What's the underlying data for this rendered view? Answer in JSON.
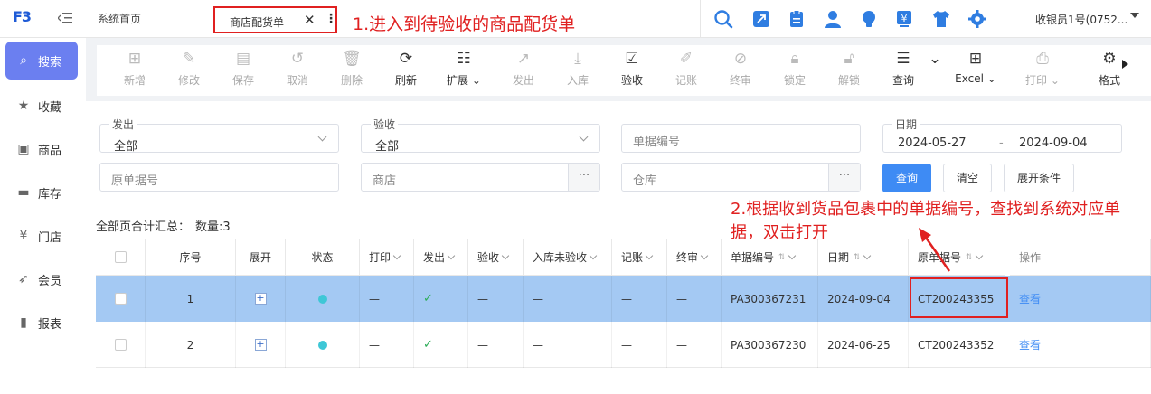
{
  "app": {
    "logo_text": "F3",
    "tabs": [
      {
        "label": "系统首页"
      },
      {
        "label": "商店配货单"
      }
    ],
    "user": "收银员1号(0752..."
  },
  "annotations": {
    "step1": "1.进入到待验收的商品配货单",
    "step2": "2.根据收到货品包裹中的单据编号，查找到系统对应单据，双击打开"
  },
  "sidebar": {
    "items": [
      {
        "label": "搜索",
        "icon": "search-icon"
      },
      {
        "label": "收藏",
        "icon": "star-icon"
      },
      {
        "label": "商品",
        "icon": "bag-icon"
      },
      {
        "label": "库存",
        "icon": "inventory-icon"
      },
      {
        "label": "门店",
        "icon": "store-icon"
      },
      {
        "label": "会员",
        "icon": "member-icon"
      },
      {
        "label": "报表",
        "icon": "report-icon"
      }
    ]
  },
  "toolbar": {
    "items": [
      {
        "label": "新增",
        "icon": "add-icon",
        "enabled": false
      },
      {
        "label": "修改",
        "icon": "edit-icon",
        "enabled": false
      },
      {
        "label": "保存",
        "icon": "save-icon",
        "enabled": false
      },
      {
        "label": "取消",
        "icon": "undo-icon",
        "enabled": false
      },
      {
        "label": "删除",
        "icon": "delete-icon",
        "enabled": false
      },
      {
        "label": "刷新",
        "icon": "refresh-icon",
        "enabled": true
      },
      {
        "label": "扩展",
        "icon": "extend-icon",
        "enabled": true
      },
      {
        "label": "发出",
        "icon": "send-icon",
        "enabled": false
      },
      {
        "label": "入库",
        "icon": "inbound-icon",
        "enabled": false
      },
      {
        "label": "验收",
        "icon": "check-icon",
        "enabled": true
      },
      {
        "label": "记账",
        "icon": "ledger-icon",
        "enabled": false
      },
      {
        "label": "终审",
        "icon": "final-review-icon",
        "enabled": false
      },
      {
        "label": "锁定",
        "icon": "lock-icon",
        "enabled": false
      },
      {
        "label": "解锁",
        "icon": "unlock-icon",
        "enabled": false
      },
      {
        "label": "查询",
        "icon": "query-icon",
        "enabled": true
      },
      {
        "label": "Excel",
        "icon": "excel-icon",
        "enabled": true
      },
      {
        "label": "打印",
        "icon": "print-icon",
        "enabled": false
      },
      {
        "label": "格式",
        "icon": "format-icon",
        "enabled": true
      }
    ]
  },
  "filters": {
    "send": {
      "label": "发出",
      "value": "全部"
    },
    "accept": {
      "label": "验收",
      "value": "全部"
    },
    "doc_no": {
      "placeholder": "单据编号"
    },
    "date": {
      "label": "日期",
      "from": "2024-05-27",
      "sep": "-",
      "to": "2024-09-04"
    },
    "orig_no": {
      "placeholder": "原单据号"
    },
    "store": {
      "placeholder": "商店"
    },
    "warehouse": {
      "placeholder": "仓库"
    },
    "dots": "···",
    "query_btn": "查询",
    "clear_btn": "清空",
    "expand_btn": "展开条件"
  },
  "summary": {
    "label": "全部页合计汇总：",
    "count_label": "数量:3"
  },
  "table": {
    "columns": [
      "",
      "序号",
      "展开",
      "状态",
      "打印",
      "发出",
      "验收",
      "入库未验收",
      "记账",
      "终审",
      "单据编号",
      "日期",
      "原单据号",
      "操作"
    ],
    "rows": [
      {
        "seq": "1",
        "print": "—",
        "send": "✓",
        "accept": "—",
        "unaccepted": "—",
        "ledger": "—",
        "final": "—",
        "doc_no": "PA300367231",
        "date": "2024-09-04",
        "orig_no": "CT200243355",
        "action": "查看"
      },
      {
        "seq": "2",
        "print": "—",
        "send": "✓",
        "accept": "—",
        "unaccepted": "—",
        "ledger": "—",
        "final": "—",
        "doc_no": "PA300367230",
        "date": "2024-06-25",
        "orig_no": "CT200243352",
        "action": "查看"
      }
    ]
  },
  "colors": {
    "accent": "#3e8bf4",
    "annotation": "#e02020",
    "selected_row": "#a4c9f3",
    "sidebar_active": "#6b7ff0"
  }
}
